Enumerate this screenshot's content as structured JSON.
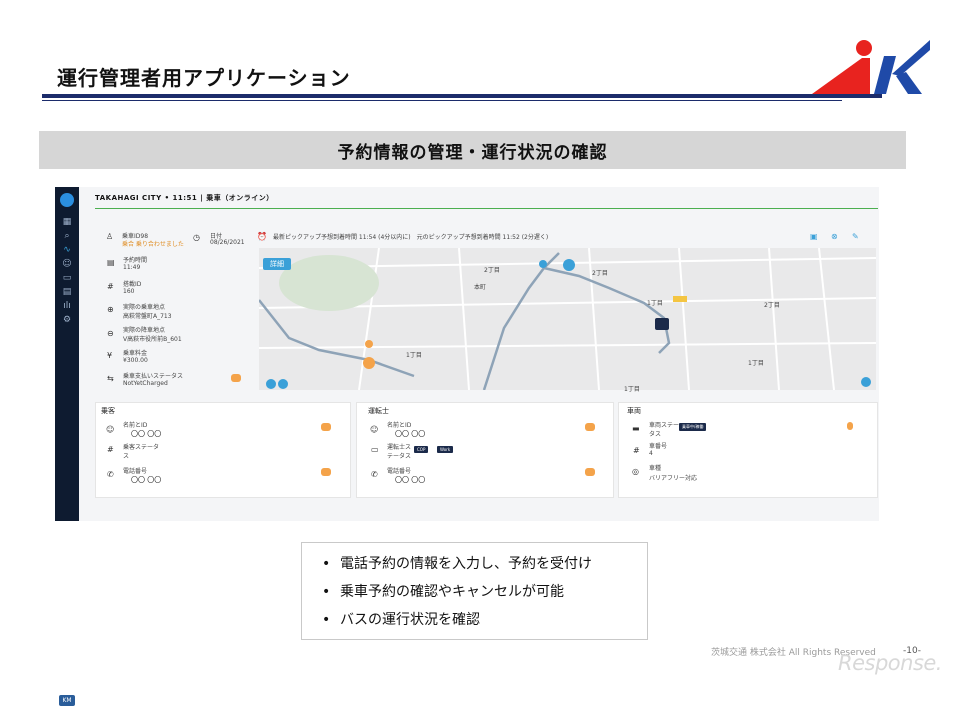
{
  "slide": {
    "title": "運行管理者用アプリケーション",
    "banner": "予約情報の管理・運行状況の確認",
    "footer": "茨城交通 株式会社 All Rights Reserved",
    "page_number": "-10-",
    "watermark": "Response."
  },
  "app": {
    "topbar": "TAKAHAGI CITY • 11:51 | 乗車（オンライン）",
    "sidebar_initials": "KM",
    "header": {
      "ride_id": "乗車ID98",
      "ride_status": "乗合 乗り合わせました",
      "date_label": "日付",
      "date_value": "08/26/2021",
      "pickup_info": "最新ピックアップ予想到着時間 11:54 (4分以内に)　元のピックアップ予想到着時間 11:52 (2分遅く)"
    },
    "details": [
      {
        "label": "予約時間",
        "value": "11:49"
      },
      {
        "label": "搭載ID",
        "value": "160"
      },
      {
        "label": "実際の乗車地点",
        "value": "高萩常盤町A_713"
      },
      {
        "label": "実際の降車地点",
        "value": "V高萩市役所前B_601"
      },
      {
        "label": "乗車料金",
        "value": "¥300.00"
      },
      {
        "label": "乗車支払いステータス",
        "value": "NotYetCharged"
      }
    ],
    "map": {
      "detail_button": "詳細",
      "labels": [
        "2丁目",
        "2丁目",
        "本町",
        "1丁目",
        "1丁目",
        "1丁目",
        "2丁目",
        "1丁目"
      ]
    },
    "passenger_card": {
      "title": "乗客",
      "name_label": "名前とID",
      "name_value": "〇〇 〇〇",
      "status_label": "乗客ステータス",
      "phone_label": "電話番号",
      "phone_value": "〇〇 〇〇"
    },
    "driver_card": {
      "title": "運転士",
      "name_label": "名前とID",
      "name_value": "〇〇 〇〇",
      "status_label": "運転士ステータス",
      "status_tags": [
        "COP",
        "Work"
      ],
      "phone_label": "電話番号",
      "phone_value": "〇〇 〇〇"
    },
    "vehicle_card": {
      "title": "車両",
      "status_label": "車両ステータス",
      "status_tag": "乗車中/稼働",
      "number_label": "車番号",
      "number_value": "4",
      "type_label": "車種",
      "type_value": "バリアフリー対応"
    }
  },
  "bullets": [
    "電話予約の情報を入力し、予約を受付け",
    "乗車予約の確認やキャンセルが可能",
    "バスの運行状況を確認"
  ],
  "colors": {
    "accent_navy": "#1c2c6b",
    "logo_red": "#e8231f",
    "logo_blue": "#1f4aa8",
    "map_route": "#8ea3b7"
  }
}
